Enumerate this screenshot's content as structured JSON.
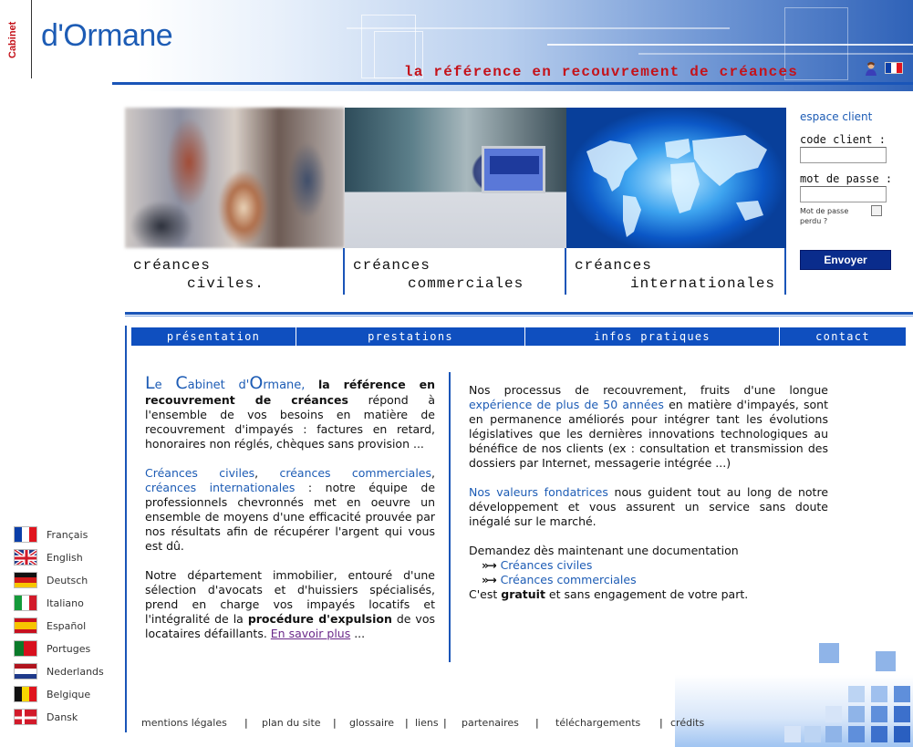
{
  "header": {
    "brand_vertical": "Cabinet",
    "brand_name": "d'Ormane",
    "tagline": "la référence en recouvrement de créances"
  },
  "panels": [
    {
      "line1": "créances",
      "line2": "civiles."
    },
    {
      "line1": "créances",
      "line2": "commerciales"
    },
    {
      "line1": "créances",
      "line2": "internationales"
    }
  ],
  "login": {
    "title": "espace client",
    "code_label": "code client :",
    "password_label": "mot de passe :",
    "forgot_label": "Mot de passe perdu ?",
    "submit_label": "Envoyer"
  },
  "nav": {
    "items": [
      "présentation",
      "prestations",
      "infos pratiques",
      "contact"
    ]
  },
  "left_column": {
    "lead_L": "L",
    "lead_e": "e ",
    "lead_C": "C",
    "lead_abinet": "abinet d'",
    "lead_O": "O",
    "lead_rmane": "rmane,",
    "p1_bold": "la référence en recouvrement de créances",
    "p1_rest": " répond à l'ensemble de vos besoins en matière de recouvrement d'impayés : factures en retard, honoraires non réglés, chèques sans provision ...",
    "p2_link1": "Créances civiles",
    "p2_comma1": ", ",
    "p2_link2": "créances commerciales",
    "p2_comma2": ", ",
    "p2_link3": "créances internationales",
    "p2_rest": " : notre équipe de professionnels chevronnés met en oeuvre un ensemble de moyens d'une efficacité prouvée par nos résultats afin de récupérer l'argent qui vous est dû.",
    "p3_text": "Notre département immobilier, entouré d'une sélection d'avocats et d'huissiers spécialisés, prend en charge vos impayés locatifs et l'intégralité de la ",
    "p3_bold": "procédure d'expulsion",
    "p3_rest": " de vos locataires défaillants. ",
    "p3_link": "En savoir plus",
    "p3_end": " ..."
  },
  "right_column": {
    "p1_start": "Nos processus de recouvrement, fruits d'une longue ",
    "p1_blue": "expérience de plus de 50 années",
    "p1_rest": " en matière d'impayés, sont en permanence améliorés pour intégrer tant les évolutions législatives que les dernières innovations technologiques au bénéfice de nos clients (ex : consultation et transmission des dossiers par Internet, messagerie intégrée ...)",
    "p2_blue": "Nos valeurs fondatrices",
    "p2_rest": " nous guident tout au long de notre développement et vous assurent un service sans doute inégalé sur le marché.",
    "p3_intro": "Demandez dès maintenant une documentation",
    "doc_link1": "Créances civiles",
    "doc_link2": "Créances commerciales",
    "p3_end_start": "C'est ",
    "p3_end_bold": "gratuit",
    "p3_end_rest": " et sans engagement de votre part.",
    "arrow_glyph": "»→"
  },
  "languages": [
    "Français",
    "English",
    "Deutsch",
    "Italiano",
    "Español",
    "Portuges",
    "Nederlands",
    "Belgique",
    "Dansk"
  ],
  "footer": {
    "links": [
      "mentions légales",
      "plan du site",
      "glossaire",
      "liens",
      "partenaires",
      "téléchargements",
      "crédits"
    ],
    "separator": "|"
  },
  "colors": {
    "brand_blue": "#1d5cb5",
    "nav_blue": "#0f4fbf",
    "tagline_red": "#c4121a",
    "button_navy": "#0a2c8c"
  }
}
